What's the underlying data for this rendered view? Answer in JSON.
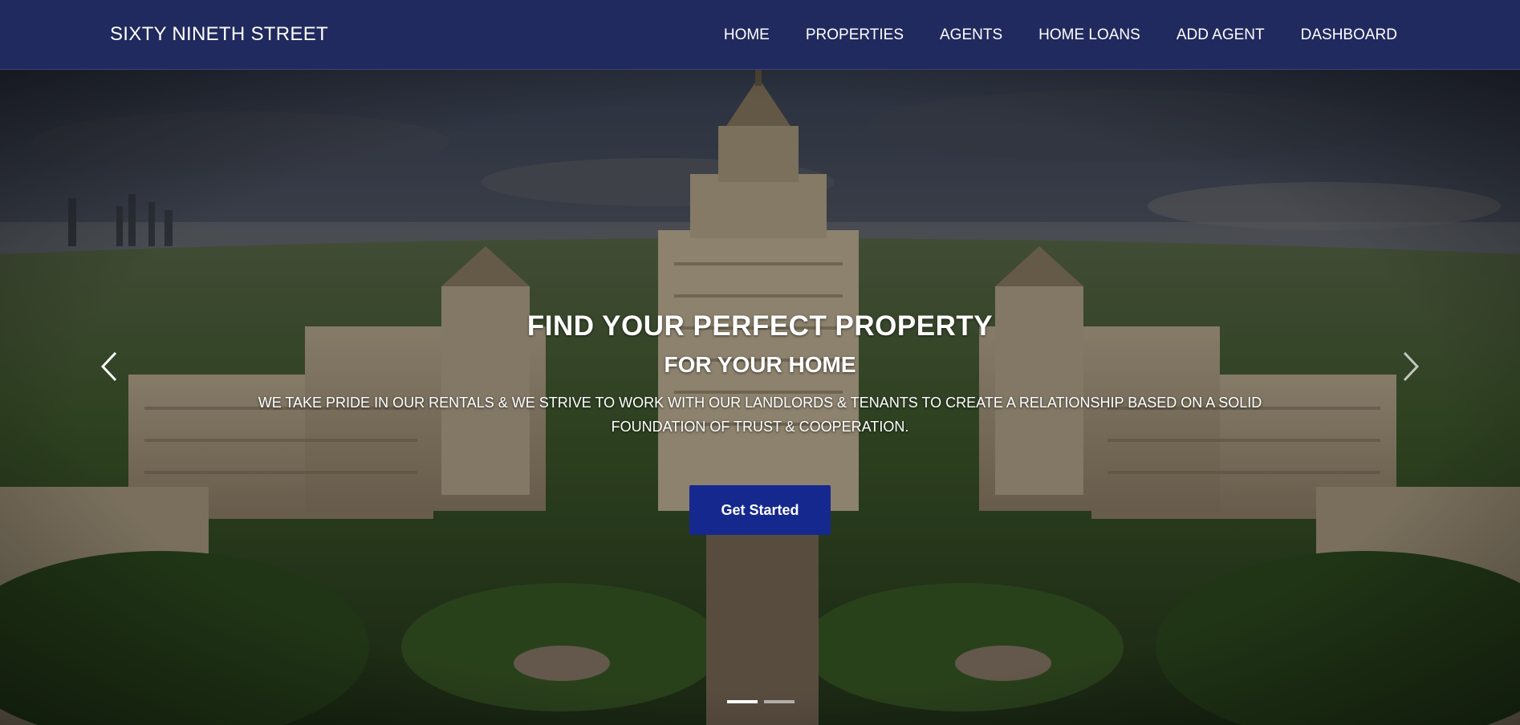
{
  "navbar": {
    "brand": "SIXTY NINETH STREET",
    "links": [
      "HOME",
      "PROPERTIES",
      "AGENTS",
      "HOME LOANS",
      "ADD AGENT",
      "DASHBOARD"
    ]
  },
  "hero": {
    "title": "FIND YOUR PERFECT PROPERTY",
    "subtitle": "FOR YOUR HOME",
    "description": "WE TAKE PRIDE IN OUR RENTALS & WE STRIVE TO WORK WITH OUR LANDLORDS & TENANTS TO CREATE A RELATIONSHIP BASED ON A SOLID FOUNDATION OF TRUST & COOPERATION.",
    "cta_label": "Get Started",
    "slides_count": 2,
    "active_slide": 1
  },
  "colors": {
    "navbar_bg": "#212a5e",
    "cta_bg": "#15288e",
    "text": "#ffffff"
  },
  "icons": {
    "prev": "chevron-left-icon",
    "next": "chevron-right-icon"
  }
}
